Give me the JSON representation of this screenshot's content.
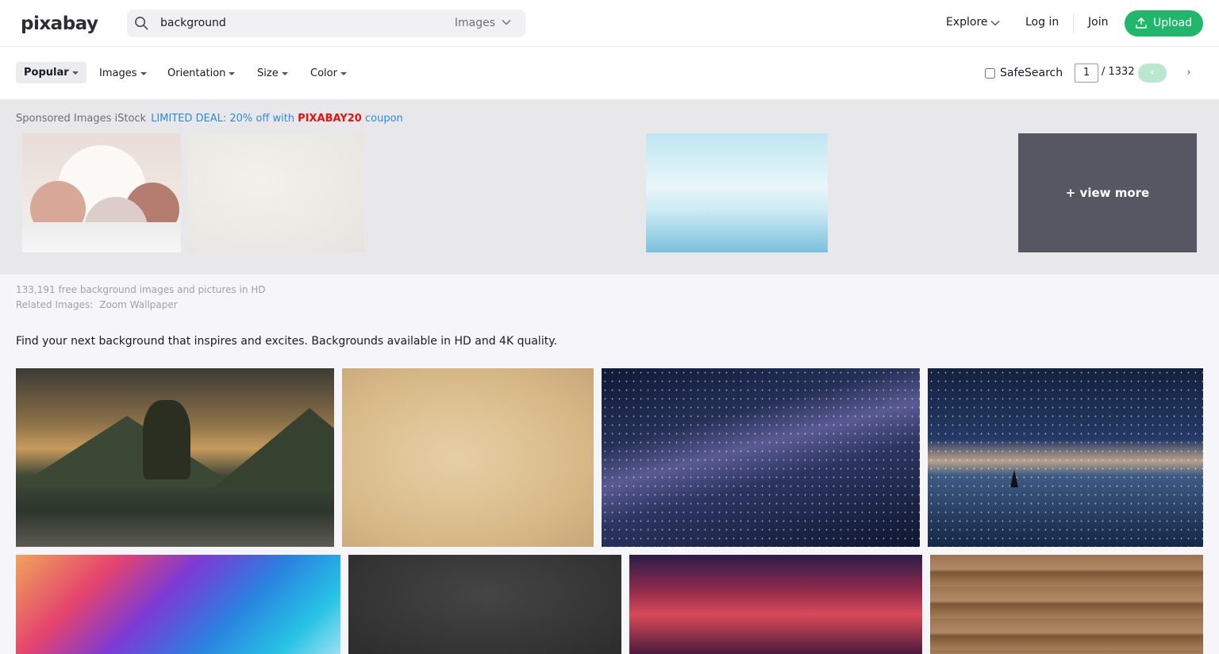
{
  "header": {
    "logo": "pixabay",
    "search_value": "background",
    "search_type": "Images",
    "nav_explore": "Explore",
    "nav_login": "Log in",
    "nav_join": "Join",
    "upload_label": "Upload"
  },
  "filters": {
    "popular": "Popular",
    "images": "Images",
    "orientation": "Orientation",
    "size": "Size",
    "color": "Color",
    "safesearch": "SafeSearch",
    "page": "1",
    "page_total": "/ 1332",
    "prev": "‹",
    "next": "›"
  },
  "sponsored": {
    "label": "Sponsored Images iStock",
    "deal_prefix": "LIMITED DEAL: 20% off with",
    "coupon_code": "PIXABAY20",
    "deal_suffix": "coupon",
    "view_more": "+ view more"
  },
  "results": {
    "count_text": "133,191 free background images and pictures in HD",
    "related_label": "Related Images:",
    "related_link": "Zoom Wallpaper",
    "description": "Find your next background that inspires and excites. Backgrounds available in HD and 4K quality."
  },
  "colors": {
    "brand_green": "#21b76a",
    "deal_blue": "#2b8cdc",
    "coupon_red": "#e61212",
    "view_more_bg": "#575663"
  }
}
